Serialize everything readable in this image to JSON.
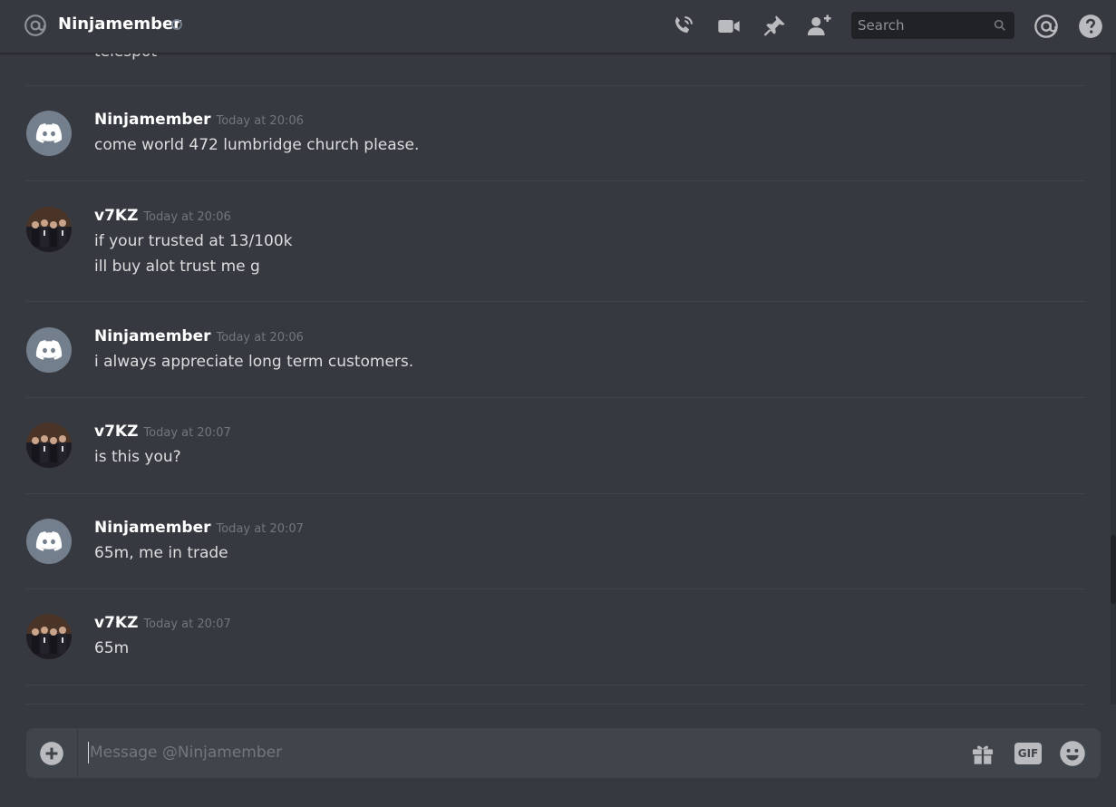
{
  "header": {
    "channel_name": "Ninjamember",
    "search_placeholder": "Search",
    "icons": [
      "at-icon",
      "status-dot",
      "call-icon",
      "video-icon",
      "pin-icon",
      "add-friend-icon",
      "search-icon",
      "mentions-icon",
      "help-icon"
    ]
  },
  "colors": {
    "background": "#36393f",
    "header_text": "#ffffff",
    "timestamp": "#72767d",
    "message_text": "#dcddde",
    "composer_bg": "#40444b",
    "discord_avatar": "#747f8d"
  },
  "messages": {
    "partial_text": "telespot",
    "items": [
      {
        "author": "Ninjamember",
        "timestamp": "Today at 20:06",
        "avatar": "discord-logo",
        "lines": [
          "come world 472 lumbridge church please."
        ]
      },
      {
        "author": "v7KZ",
        "timestamp": "Today at 20:06",
        "avatar": "photo",
        "lines": [
          "if your trusted at 13/100k",
          "ill buy alot trust me g"
        ]
      },
      {
        "author": "Ninjamember",
        "timestamp": "Today at 20:06",
        "avatar": "discord-logo",
        "lines": [
          "i always appreciate long term customers."
        ]
      },
      {
        "author": "v7KZ",
        "timestamp": "Today at 20:07",
        "avatar": "photo",
        "lines": [
          "is this you?"
        ]
      },
      {
        "author": "Ninjamember",
        "timestamp": "Today at 20:07",
        "avatar": "discord-logo",
        "lines": [
          "65m, me in trade"
        ]
      },
      {
        "author": "v7KZ",
        "timestamp": "Today at 20:07",
        "avatar": "photo",
        "lines": [
          "65m"
        ]
      }
    ]
  },
  "composer": {
    "placeholder": "Message @Ninjamember",
    "gif_label": "GIF"
  }
}
